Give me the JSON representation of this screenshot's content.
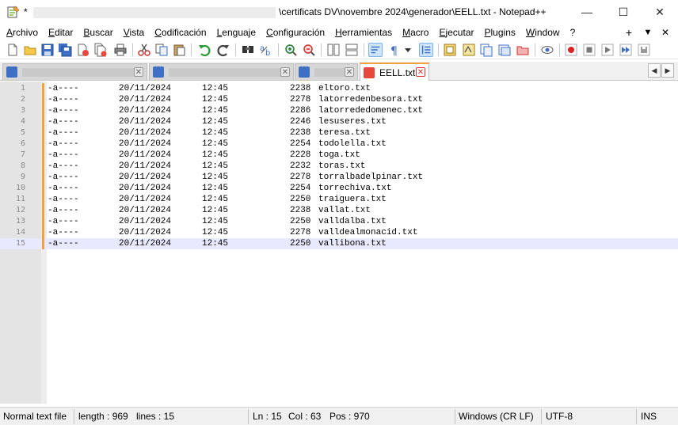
{
  "window": {
    "title_prefix": "*",
    "title": "\\certificats DV\\novembre 2024\\generador\\EELL.txt - Notepad++",
    "minimize_symbol": "—",
    "maximize_symbol": "☐",
    "close_symbol": "✕"
  },
  "menu": {
    "items": [
      "Archivo",
      "Editar",
      "Buscar",
      "Vista",
      "Codificación",
      "Lenguaje",
      "Configuración",
      "Herramientas",
      "Macro",
      "Ejecutar",
      "Plugins",
      "Window",
      "?"
    ],
    "right": [
      "+",
      "▼",
      "✕"
    ]
  },
  "toolbar": {
    "icons": [
      "new-file-icon",
      "open-file-icon",
      "save-icon",
      "save-all-icon",
      "close-icon",
      "close-all-icon",
      "print-icon",
      "cut-icon",
      "copy-icon",
      "paste-icon",
      "undo-icon",
      "redo-icon",
      "find-icon",
      "replace-icon",
      "zoom-in-icon",
      "zoom-out-icon",
      "sync-vertical-icon",
      "sync-horizontal-icon",
      "word-wrap-icon",
      "show-all-chars-icon",
      "dropdown-icon",
      "indent-guide-icon",
      "user-lang-icon",
      "doc-map-icon",
      "function-list-icon",
      "folder-workspace-icon",
      "doc-switcher-icon",
      "monitoring-icon",
      "record-macro-icon",
      "stop-macro-icon",
      "play-macro-icon",
      "run-macro-multiple-icon",
      "save-macro-icon"
    ]
  },
  "tabs": [
    {
      "label": "",
      "active": false,
      "close": "✕"
    },
    {
      "label": "",
      "active": false,
      "close": "✕"
    },
    {
      "label": "",
      "active": false,
      "close": "✕"
    },
    {
      "label": "EELL.txt",
      "active": true,
      "close": "✕"
    }
  ],
  "tab_scroll": {
    "left": "◀",
    "right": "▶"
  },
  "editor": {
    "current_line": 15,
    "lines": [
      {
        "n": "1",
        "attr": "-a----",
        "date": "20/11/2024",
        "time": "12:45",
        "size": "2238",
        "name": "eltoro.txt"
      },
      {
        "n": "2",
        "attr": "-a----",
        "date": "20/11/2024",
        "time": "12:45",
        "size": "2278",
        "name": "latorredenbesora.txt"
      },
      {
        "n": "3",
        "attr": "-a----",
        "date": "20/11/2024",
        "time": "12:45",
        "size": "2286",
        "name": "latorrededomenec.txt"
      },
      {
        "n": "4",
        "attr": "-a----",
        "date": "20/11/2024",
        "time": "12:45",
        "size": "2246",
        "name": "lesuseres.txt"
      },
      {
        "n": "5",
        "attr": "-a----",
        "date": "20/11/2024",
        "time": "12:45",
        "size": "2238",
        "name": "teresa.txt"
      },
      {
        "n": "6",
        "attr": "-a----",
        "date": "20/11/2024",
        "time": "12:45",
        "size": "2254",
        "name": "todolella.txt"
      },
      {
        "n": "7",
        "attr": "-a----",
        "date": "20/11/2024",
        "time": "12:45",
        "size": "2228",
        "name": "toga.txt"
      },
      {
        "n": "8",
        "attr": "-a----",
        "date": "20/11/2024",
        "time": "12:45",
        "size": "2232",
        "name": "toras.txt"
      },
      {
        "n": "9",
        "attr": "-a----",
        "date": "20/11/2024",
        "time": "12:45",
        "size": "2278",
        "name": "torralbadelpinar.txt"
      },
      {
        "n": "10",
        "attr": "-a----",
        "date": "20/11/2024",
        "time": "12:45",
        "size": "2254",
        "name": "torrechiva.txt"
      },
      {
        "n": "11",
        "attr": "-a----",
        "date": "20/11/2024",
        "time": "12:45",
        "size": "2250",
        "name": "traiguera.txt"
      },
      {
        "n": "12",
        "attr": "-a----",
        "date": "20/11/2024",
        "time": "12:45",
        "size": "2238",
        "name": "vallat.txt"
      },
      {
        "n": "13",
        "attr": "-a----",
        "date": "20/11/2024",
        "time": "12:45",
        "size": "2250",
        "name": "valldalba.txt"
      },
      {
        "n": "14",
        "attr": "-a----",
        "date": "20/11/2024",
        "time": "12:45",
        "size": "2278",
        "name": "valldealmonacid.txt"
      },
      {
        "n": "15",
        "attr": "-a----",
        "date": "20/11/2024",
        "time": "12:45",
        "size": "2250",
        "name": "vallibona.txt"
      }
    ]
  },
  "status": {
    "file_type": "Normal text file",
    "length": "length : 969",
    "lines": "lines : 15",
    "ln": "Ln : 15",
    "col": "Col : 63",
    "pos": "Pos : 970",
    "eol": "Windows (CR LF)",
    "encoding": "UTF-8",
    "mode": "INS"
  },
  "colors": {
    "accent": "#f2a13c",
    "current_line_bg": "#e8e8ff",
    "gutter_bg": "#e4e4e4"
  }
}
